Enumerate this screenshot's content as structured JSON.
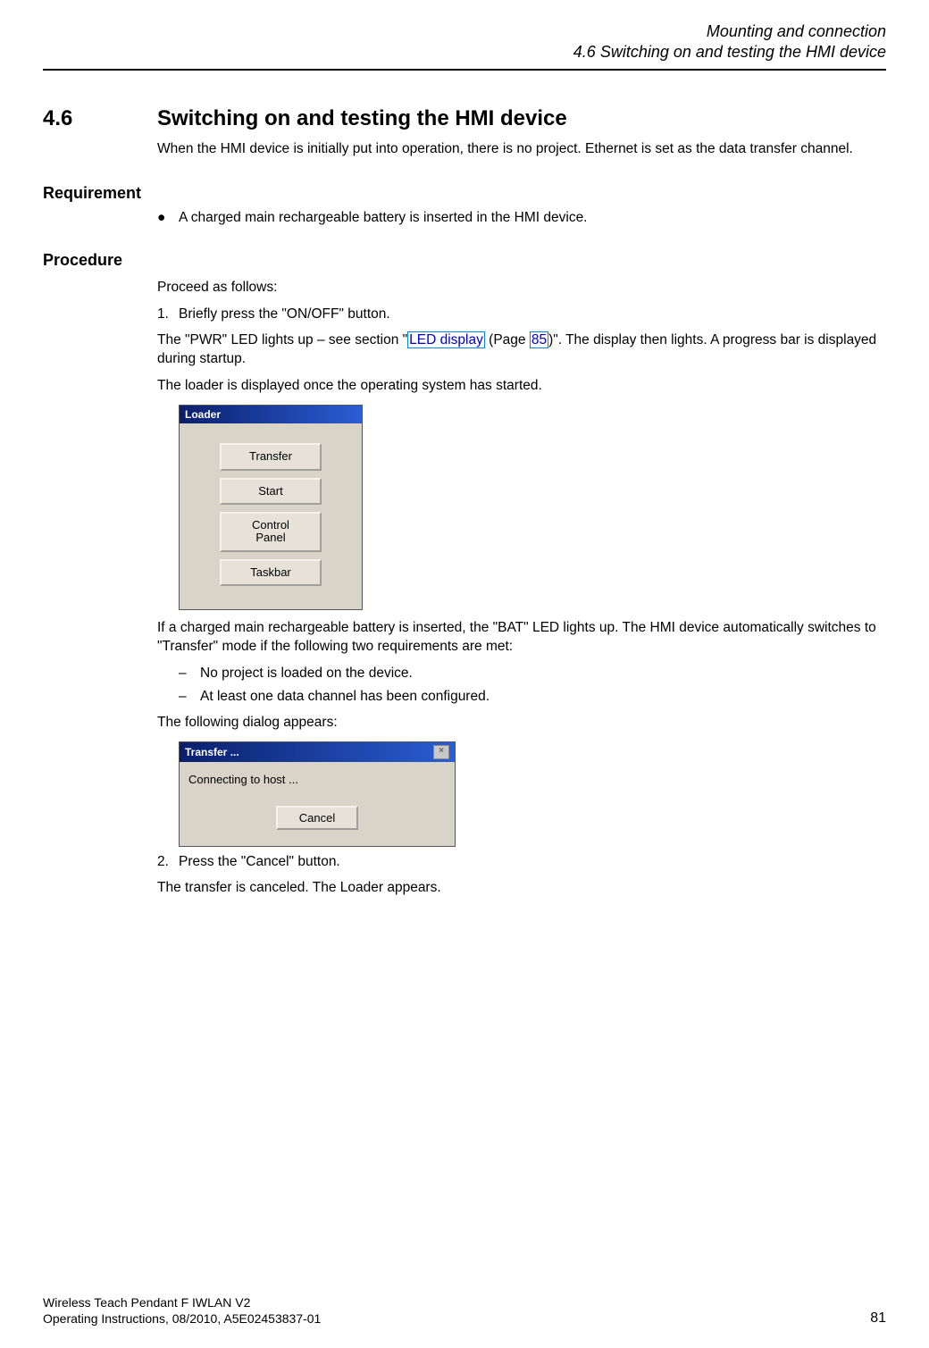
{
  "header": {
    "line1": "Mounting and connection",
    "line2": "4.6 Switching on and testing the HMI device"
  },
  "section": {
    "number": "4.6",
    "title": "Switching on and testing the HMI device",
    "intro": "When the HMI device is initially put into operation, there is no project. Ethernet is set as the data transfer channel."
  },
  "requirement": {
    "heading": "Requirement",
    "item": "A charged main rechargeable battery is inserted in the HMI device."
  },
  "procedure": {
    "heading": "Procedure",
    "intro": "Proceed as follows:",
    "step1": {
      "num": "1.",
      "text": "Briefly press the \"ON/OFF\" button.",
      "p1_pre": "The \"PWR\" LED lights up – see section \"",
      "p1_link1": "LED display",
      "p1_mid": " (Page ",
      "p1_link2": "85",
      "p1_post": ")\". The display then lights. A progress bar is displayed during startup.",
      "p2": "The loader is displayed once the operating system has started.",
      "p3": "If a charged main rechargeable battery is inserted, the \"BAT\" LED lights up. The HMI device automatically switches to \"Transfer\" mode if the following two requirements are met:",
      "dash1": "No project is loaded on the device.",
      "dash2": "At least one data channel has been configured.",
      "p4": "The following dialog appears:"
    },
    "step2": {
      "num": "2.",
      "text": "Press the \"Cancel\" button.",
      "p1": "The transfer is canceled. The Loader appears."
    }
  },
  "loader": {
    "title": "Loader",
    "buttons": {
      "transfer": "Transfer",
      "start": "Start",
      "control_panel": "Control\nPanel",
      "taskbar": "Taskbar"
    }
  },
  "transfer": {
    "title": "Transfer ...",
    "status": "Connecting to host ...",
    "cancel": "Cancel"
  },
  "footer": {
    "line1": "Wireless Teach Pendant F IWLAN V2",
    "line2": "Operating Instructions, 08/2010, A5E02453837-01",
    "page": "81"
  }
}
